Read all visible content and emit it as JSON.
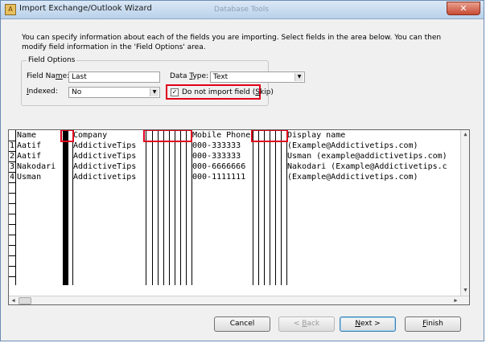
{
  "window": {
    "title": "Import Exchange/Outlook Wizard",
    "close_glyph": "✕",
    "background_ghost": [
      "Database Tools"
    ]
  },
  "description": "You can specify information about each of the fields you are importing. Select fields in the area below. You can then modify field information in the 'Field Options' area.",
  "field_options": {
    "legend": "Field Options",
    "field_name": {
      "label_pre": "Field Na",
      "label_key": "m",
      "label_post": "e:",
      "value": "Last"
    },
    "data_type": {
      "label_pre": "Data ",
      "label_key": "T",
      "label_post": "ype:",
      "value": "Text"
    },
    "indexed": {
      "label_pre": "",
      "label_key": "I",
      "label_post": "ndexed:",
      "value": "No"
    },
    "skip": {
      "checked_glyph": "✓",
      "label_pre": "Do not import field (",
      "label_key": "S",
      "label_post": "kip)"
    }
  },
  "grid": {
    "headers": {
      "name": "Name",
      "company": "Company",
      "mobile_phone": "Mobile Phone",
      "display_name": "Display name"
    },
    "rows": [
      {
        "num": "1",
        "name": "Aatif",
        "company": "AddictiveTips",
        "mobile": "000-333333",
        "display": "(Example@Addictivetips.com)"
      },
      {
        "num": "2",
        "name": "Aatif",
        "company": "AddictiveTips",
        "mobile": "000-333333",
        "display": "Usman (example@addictivetips.com)"
      },
      {
        "num": "3",
        "name": "Nakodari",
        "company": "AddictiveTips",
        "mobile": "000-6666666",
        "display": "Nakodari (Example@Addictivetips.c"
      },
      {
        "num": "4",
        "name": "Usman",
        "company": "Addictivetips",
        "mobile": "000-1111111",
        "display": "(Example@Addictivetips.com)"
      }
    ]
  },
  "buttons": {
    "cancel": "Cancel",
    "back": "< Back",
    "next": "Next >",
    "finish": "Finish",
    "back_key": "B",
    "next_key": "N",
    "finish_key": "F"
  },
  "icons": {
    "app": "access-icon",
    "dropdown": "chevron-down-icon",
    "scroll_left": "arrow-left-icon",
    "scroll_right": "arrow-right-icon",
    "scroll_up": "arrow-up-icon",
    "scroll_down": "arrow-down-icon"
  },
  "colors": {
    "highlight": "#e0001b",
    "selected_column": "#000000"
  }
}
